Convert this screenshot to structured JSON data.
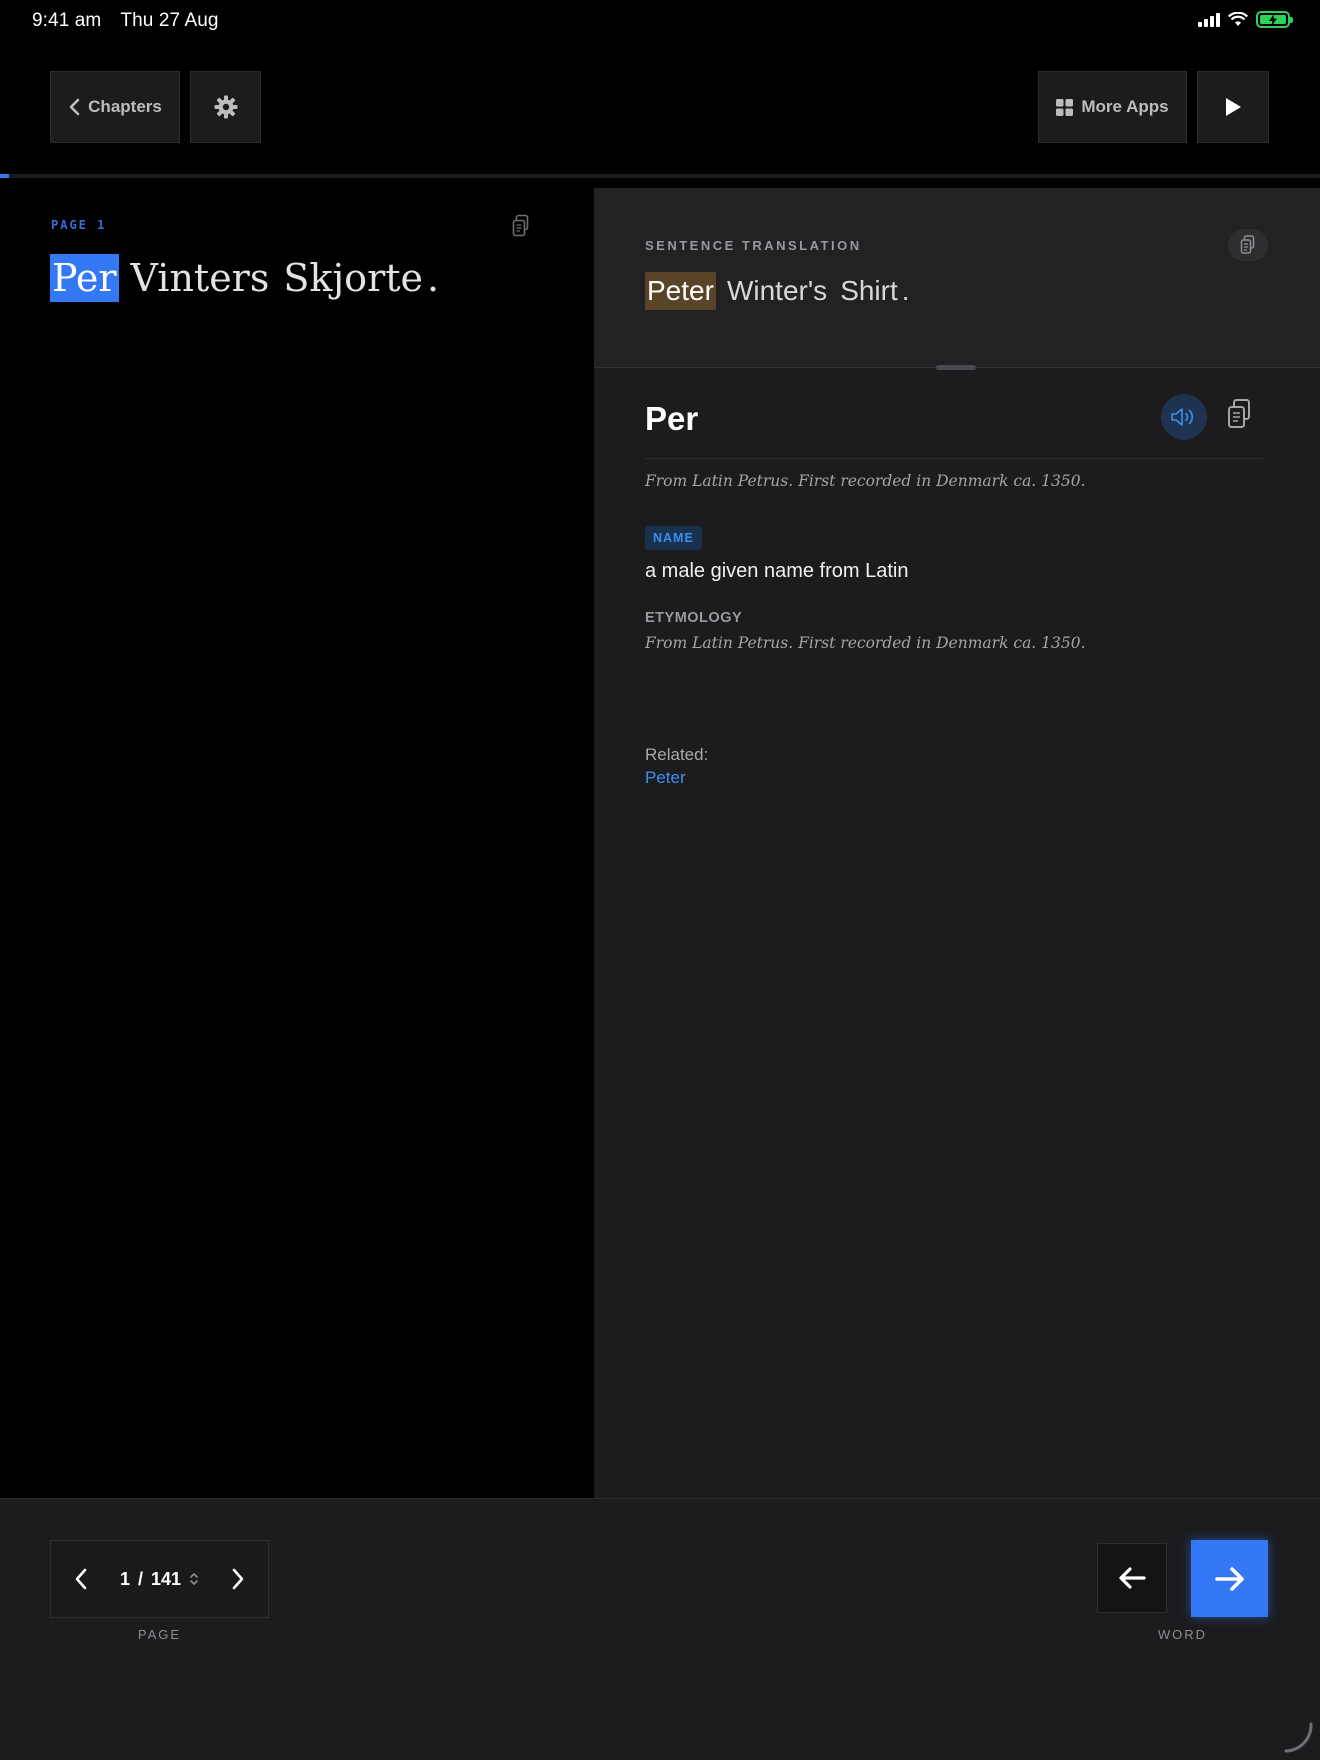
{
  "status_bar": {
    "time": "9:41 am",
    "date": "Thu 27 Aug"
  },
  "toolbar": {
    "chapters_label": "Chapters",
    "more_apps_label": "More Apps",
    "icons": [
      "chevron-left-icon",
      "gear-icon",
      "grid-icon",
      "play-icon"
    ]
  },
  "reading_progress": 0.007,
  "source": {
    "page_label": "PAGE 1",
    "words": [
      "Per",
      "Vinters",
      "Skjorte",
      "."
    ],
    "active_word_index": 0
  },
  "translation": {
    "label": "SENTENCE TRANSLATION",
    "words": [
      "Peter",
      "Winter's",
      "Shirt",
      "."
    ],
    "active_word_index": 0
  },
  "entry": {
    "headword": "Per",
    "etymology_short": "From Latin Petrus. First recorded in Denmark ca. 1350.",
    "part_of_speech": "NAME",
    "definition": "a male given name from Latin",
    "etymology_label": "ETYMOLOGY",
    "etymology": "From Latin Petrus. First recorded in Denmark ca. 1350.",
    "related_label": "Related:",
    "related": [
      "Peter"
    ]
  },
  "footer": {
    "current_page": "1",
    "separator": "/",
    "total_pages": "141",
    "page_label": "PAGE",
    "word_label": "WORD"
  },
  "colors": {
    "accent": "#3478f6",
    "link": "#3d8ff0",
    "translation_highlight": "#5a4428",
    "panel": "#1c1c1e",
    "background": "#000000"
  }
}
